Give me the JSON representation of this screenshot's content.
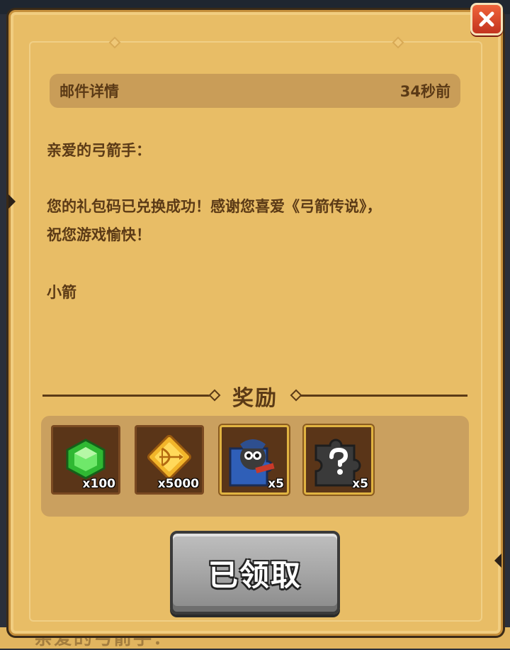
{
  "mail": {
    "header_title": "邮件详情",
    "time_ago": "34秒前",
    "greeting": "亲爱的弓箭手：",
    "line1": "您的礼包码已兑换成功！感谢您喜爱《弓箭传说》，",
    "line2": "祝您游戏愉快！",
    "signature": "小箭"
  },
  "rewards": {
    "title": "奖励",
    "items": [
      {
        "icon": "green-gem-icon",
        "quantity": "x100"
      },
      {
        "icon": "bow-coin-icon",
        "quantity": "x5000"
      },
      {
        "icon": "hero-puzzle-piece-icon",
        "quantity": "x5"
      },
      {
        "icon": "mystery-puzzle-piece-icon",
        "quantity": "x5"
      }
    ]
  },
  "buttons": {
    "claimed_label": "已领取"
  },
  "background": {
    "bottom_text": "亲爱的弓箭手："
  },
  "colors": {
    "panel": "#e8bd66",
    "header_bar": "#c99d58",
    "text": "#5b3a16",
    "close_button": "#e04a2a",
    "claim_button_disabled": "#a3a3a3"
  }
}
